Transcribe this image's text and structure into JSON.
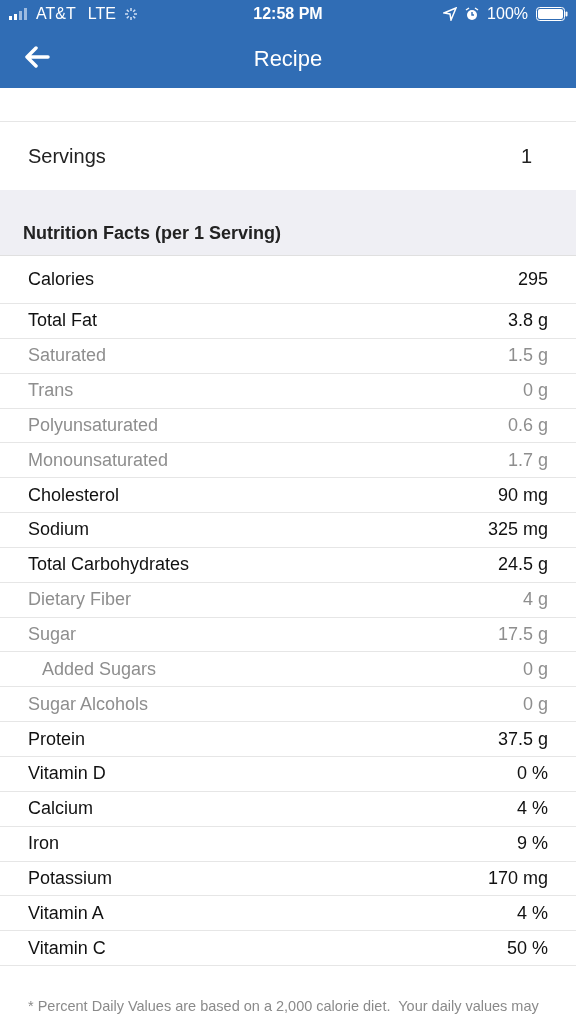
{
  "status_bar": {
    "carrier": "AT&T",
    "network": "LTE",
    "time": "12:58 PM",
    "battery": "100%"
  },
  "nav": {
    "title": "Recipe"
  },
  "fields": [
    {
      "label": "Servings",
      "value": "1"
    }
  ],
  "nutrition": {
    "heading": "Nutrition Facts (per 1 Serving)",
    "rows": [
      {
        "kind": "main",
        "label": "Calories",
        "value": "295"
      },
      {
        "kind": "main",
        "label": "Total Fat",
        "value": "3.8 g"
      },
      {
        "kind": "sub",
        "label": "Saturated",
        "value": "1.5 g"
      },
      {
        "kind": "sub",
        "label": "Trans",
        "value": "0 g"
      },
      {
        "kind": "sub",
        "label": "Polyunsaturated",
        "value": "0.6 g"
      },
      {
        "kind": "sub",
        "label": "Monounsaturated",
        "value": "1.7 g"
      },
      {
        "kind": "main",
        "label": "Cholesterol",
        "value": "90 mg"
      },
      {
        "kind": "main",
        "label": "Sodium",
        "value": "325 mg"
      },
      {
        "kind": "main",
        "label": "Total Carbohydrates",
        "value": "24.5 g"
      },
      {
        "kind": "sub",
        "label": "Dietary Fiber",
        "value": "4 g"
      },
      {
        "kind": "sub",
        "label": "Sugar",
        "value": "17.5 g"
      },
      {
        "kind": "subsub",
        "label": "Added Sugars",
        "value": "0 g"
      },
      {
        "kind": "sub",
        "label": "Sugar Alcohols",
        "value": "0 g"
      },
      {
        "kind": "main",
        "label": "Protein",
        "value": "37.5 g"
      },
      {
        "kind": "main",
        "label": "Vitamin D",
        "value": "0 %"
      },
      {
        "kind": "main",
        "label": "Calcium",
        "value": "4 %"
      },
      {
        "kind": "main",
        "label": "Iron",
        "value": "9 %"
      },
      {
        "kind": "main",
        "label": "Potassium",
        "value": "170 mg"
      },
      {
        "kind": "main",
        "label": "Vitamin A",
        "value": "4 %"
      },
      {
        "kind": "main",
        "label": "Vitamin C",
        "value": "50 %"
      }
    ]
  },
  "footnote": "* Percent Daily Values are based on a 2,000 calorie diet.  Your daily values may"
}
